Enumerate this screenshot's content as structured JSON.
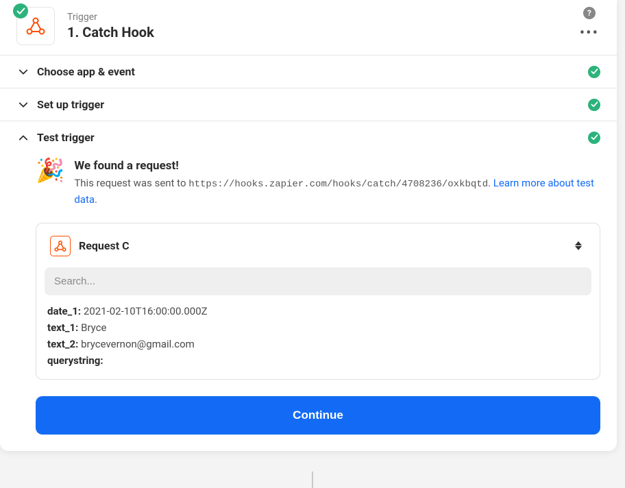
{
  "header": {
    "label": "Trigger",
    "title": "1. Catch Hook"
  },
  "sections": {
    "choose": {
      "title": "Choose app & event"
    },
    "setup": {
      "title": "Set up trigger"
    },
    "test": {
      "title": "Test trigger"
    }
  },
  "found": {
    "heading": "We found a request!",
    "prefix": "This request was sent to ",
    "url": "https://hooks.zapier.com/hooks/catch/4708236/oxkbqtd",
    "suffix": ". ",
    "link": "Learn more about test data",
    "tail": "."
  },
  "request": {
    "selected": "Request C",
    "search_placeholder": "Search...",
    "fields": [
      {
        "key": "date_1:",
        "value": "2021-02-10T16:00:00.000Z"
      },
      {
        "key": "text_1:",
        "value": "Bryce"
      },
      {
        "key": "text_2:",
        "value": "brycevernon@gmail.com"
      },
      {
        "key": "querystring:",
        "value": ""
      }
    ]
  },
  "actions": {
    "continue": "Continue"
  },
  "help_glyph": "?",
  "party_glyph": "🎉"
}
